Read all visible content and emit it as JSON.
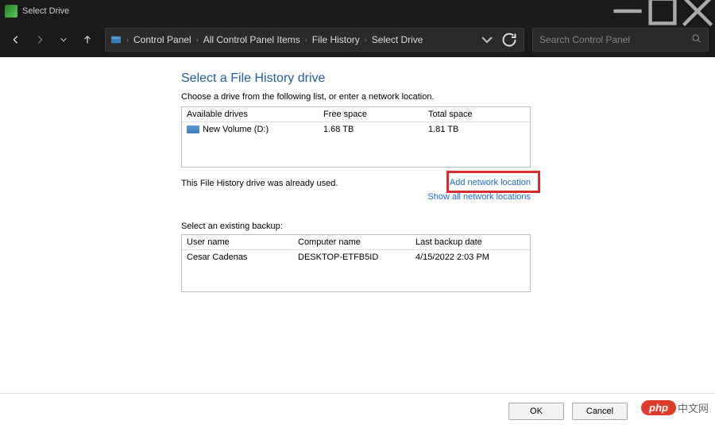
{
  "window": {
    "title": "Select Drive"
  },
  "breadcrumb": {
    "items": [
      "Control Panel",
      "All Control Panel Items",
      "File History",
      "Select Drive"
    ]
  },
  "search": {
    "placeholder": "Search Control Panel"
  },
  "main": {
    "heading": "Select a File History drive",
    "instruction": "Choose a drive from the following list, or enter a network location.",
    "drives_header": {
      "c1": "Available drives",
      "c2": "Free space",
      "c3": "Total space"
    },
    "drives": [
      {
        "name": "New Volume (D:)",
        "free": "1.68 TB",
        "total": "1.81 TB"
      }
    ],
    "used_msg": "This File History drive was already used.",
    "links": {
      "add": "Add network location",
      "show": "Show all network locations"
    },
    "backup_label": "Select an existing backup:",
    "backup_header": {
      "b1": "User name",
      "b2": "Computer name",
      "b3": "Last backup date"
    },
    "backups": [
      {
        "user": "Cesar Cadenas",
        "computer": "DESKTOP-ETFB5ID",
        "date": "4/15/2022 2:03 PM"
      }
    ]
  },
  "footer": {
    "ok": "OK",
    "cancel": "Cancel"
  },
  "watermark": {
    "pill": "php",
    "text": "中文网"
  }
}
